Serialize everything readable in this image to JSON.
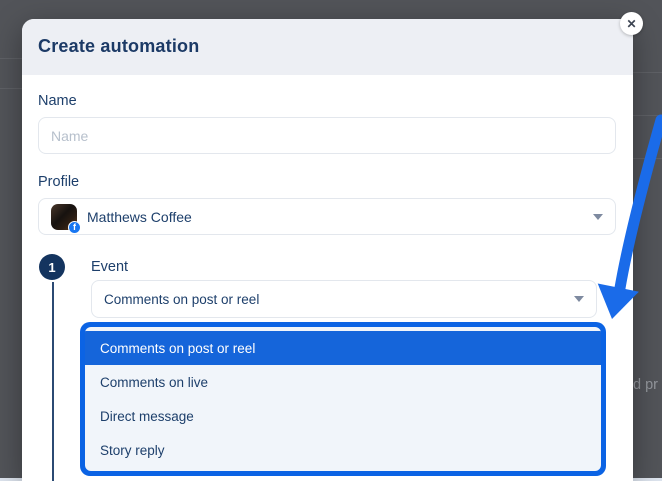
{
  "backdrop": {
    "text_fragment": "d pr"
  },
  "modal": {
    "title": "Create automation",
    "close_label": "✕",
    "form": {
      "name_label": "Name",
      "name_placeholder": "Name",
      "profile_label": "Profile",
      "profile_value": "Matthews Coffee",
      "facebook_badge": "f"
    },
    "step": {
      "number": "1",
      "label": "Event"
    },
    "event_select": {
      "value": "Comments on post or reel"
    },
    "dropdown": {
      "selected_index": 0,
      "options": [
        {
          "label": "Comments on post or reel"
        },
        {
          "label": "Comments on live"
        },
        {
          "label": "Direct message"
        },
        {
          "label": "Story reply"
        }
      ]
    }
  },
  "colors": {
    "backdrop": "#525459",
    "modal_header": "#edeff4",
    "text_navy": "#1d3f6b",
    "dropdown_border_blue": "#0b63e4",
    "selected_option_blue": "#1565da",
    "arrow_blue": "#1a6be9",
    "facebook_blue": "#1877f2",
    "step_badge_navy": "#14345f"
  }
}
